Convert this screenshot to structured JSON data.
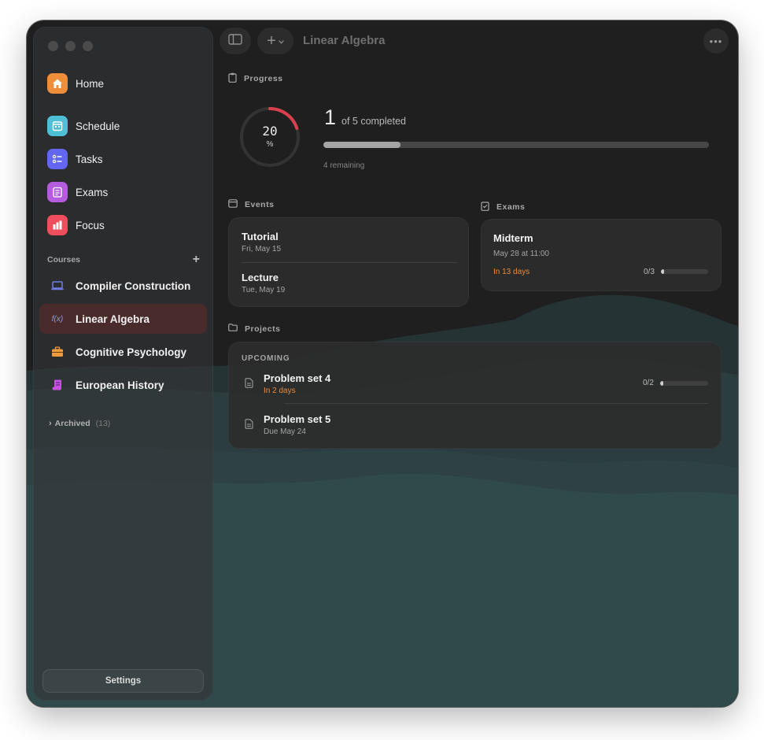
{
  "window": {
    "title": "Linear Algebra"
  },
  "sidebar": {
    "nav": [
      {
        "label": "Home",
        "icon": "home-icon",
        "color": "#ee8d3a"
      },
      {
        "label": "Schedule",
        "icon": "calendar-icon",
        "color": "#4fbfd6"
      },
      {
        "label": "Tasks",
        "icon": "checklist-icon",
        "color": "#6366f1"
      },
      {
        "label": "Exams",
        "icon": "exam-icon",
        "color": "#b45be0"
      },
      {
        "label": "Focus",
        "icon": "bar-chart-icon",
        "color": "#ef4f5c"
      }
    ],
    "courses_label": "Courses",
    "courses": [
      {
        "label": "Compiler Construction",
        "icon": "laptop-icon",
        "color": "#6d7de6"
      },
      {
        "label": "Linear Algebra",
        "icon": "function-icon",
        "glyph": "f(x)",
        "color": "#8aa1e0",
        "active": true
      },
      {
        "label": "Cognitive Psychology",
        "icon": "briefcase-icon",
        "color": "#ee9b3d"
      },
      {
        "label": "European History",
        "icon": "scroll-icon",
        "color": "#c254df"
      }
    ],
    "archived": {
      "label": "Archived",
      "count": "(13)"
    },
    "settings_label": "Settings"
  },
  "progress": {
    "title": "Progress",
    "percent": "20",
    "percent_symbol": "%",
    "percent_value": 20,
    "completed": "1",
    "of_text": "of 5 completed",
    "bar_fraction": 0.2,
    "remaining": "4 remaining"
  },
  "events": {
    "title": "Events",
    "items": [
      {
        "name": "Tutorial",
        "date": "Fri, May 15"
      },
      {
        "name": "Lecture",
        "date": "Tue, May 19"
      }
    ]
  },
  "exams": {
    "title": "Exams",
    "items": [
      {
        "name": "Midterm",
        "date": "May 28 at 11:00",
        "countdown": "In 13 days",
        "progress": "0/3"
      }
    ]
  },
  "projects": {
    "title": "Projects",
    "group_label": "UPCOMING",
    "items": [
      {
        "name": "Problem set 4",
        "due": "In 2 days",
        "progress": "0/2"
      },
      {
        "name": "Problem set 5",
        "due": "Due May 24"
      }
    ]
  },
  "colors": {
    "accent_red": "#d8404d",
    "orange_text": "#e98a3a",
    "teal_bg": "#2f4647"
  }
}
